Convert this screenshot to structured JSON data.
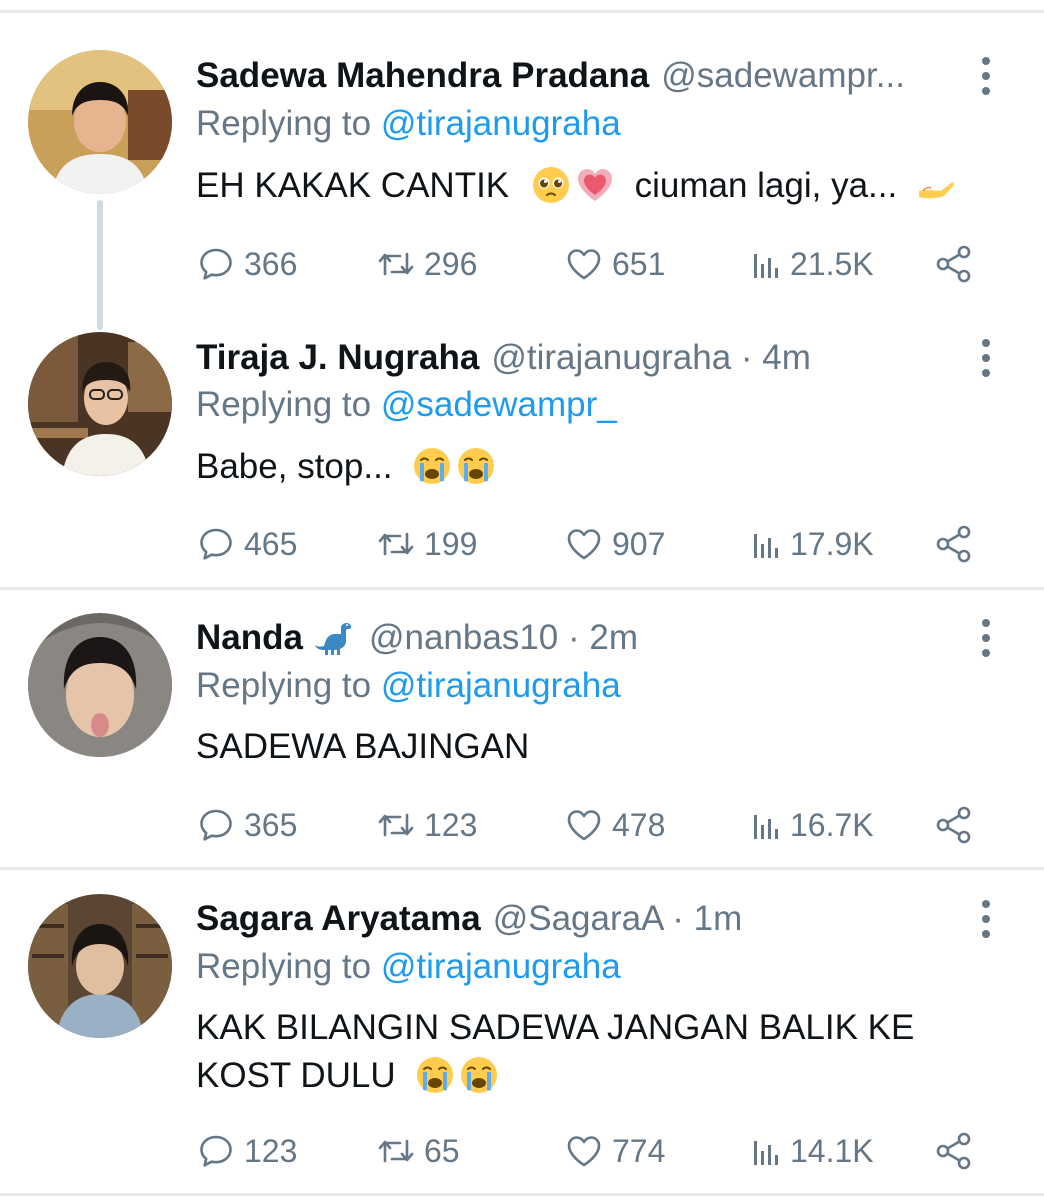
{
  "tweets": [
    {
      "name": "Sadewa Mahendra Pradana",
      "handle": "@sadewampr...",
      "replying_prefix": "Replying to",
      "replying_to": "@tirajanugraha",
      "text": "EH KAKAK CANTIK",
      "text_after": "ciuman lagi, ya...",
      "stats": {
        "replies": "366",
        "retweets": "296",
        "likes": "651",
        "views": "21.5K"
      }
    },
    {
      "name": "Tiraja J. Nugraha",
      "handle": "@tirajanugraha · 4m",
      "replying_prefix": "Replying to",
      "replying_to": "@sadewampr_",
      "text": "Babe, stop...",
      "stats": {
        "replies": "465",
        "retweets": "199",
        "likes": "907",
        "views": "17.9K"
      }
    },
    {
      "name": "Nanda",
      "handle": "@nanbas10 · 2m",
      "replying_prefix": "Replying to",
      "replying_to": "@tirajanugraha",
      "text": "SADEWA BAJINGAN",
      "stats": {
        "replies": "365",
        "retweets": "123",
        "likes": "478",
        "views": "16.7K"
      }
    },
    {
      "name": "Sagara Aryatama",
      "handle": "@SagaraA · 1m",
      "replying_prefix": "Replying to",
      "replying_to": "@tirajanugraha",
      "text_line1": "KAK BILANGIN SADEWA JANGAN BALIK KE",
      "text_line2": "KOST DULU",
      "stats": {
        "replies": "123",
        "retweets": "65",
        "likes": "774",
        "views": "14.1K"
      }
    }
  ],
  "icons": {
    "reply": "speech-bubble-icon",
    "retweet": "retweet-icon",
    "like": "heart-icon",
    "views": "analytics-bars-icon",
    "share": "share-icon",
    "more": "more-vertical-icon"
  },
  "colors": {
    "text": "#0f1419",
    "muted": "#657786",
    "link": "#1d9bf0",
    "divider": "#e6e9ec",
    "thread_line": "#cfd9de"
  }
}
